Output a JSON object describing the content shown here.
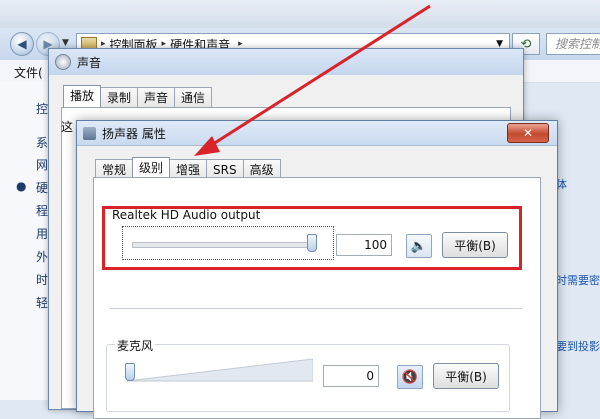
{
  "explorer": {
    "address_crumbs": [
      "控制面板",
      "硬件和声音"
    ],
    "search_placeholder": "搜索控制面",
    "menu": {
      "file": "文件("
    },
    "left_items": [
      "控",
      "系",
      "网",
      "硬",
      "程",
      "用",
      "外",
      "时",
      "轻"
    ],
    "right_fragments": [
      "体",
      "时需要密",
      "要到投影"
    ]
  },
  "sound_dialog": {
    "title": "声音",
    "tabs": [
      "播放",
      "录制",
      "声音",
      "通信"
    ],
    "active_tab": "播放",
    "panel_glyph": "这"
  },
  "speaker_dialog": {
    "title": "扬声器 属性",
    "close_label": "✕",
    "tabs": [
      "常规",
      "级别",
      "增强",
      "SRS",
      "高级"
    ],
    "active_tab": "级别",
    "output": {
      "label": "Realtek HD Audio output",
      "value": "100",
      "level": 1.0,
      "balance_label": "平衡(B)",
      "muted": false
    },
    "microphone": {
      "label": "麦克风",
      "value": "0",
      "level": 0.0,
      "balance_label": "平衡(B)",
      "muted": true
    }
  },
  "colors": {
    "annotation_red": "#d8232a",
    "accent_blue": "#2a5fb0"
  },
  "icons": [
    "back-icon",
    "forward-icon",
    "dropdown-icon",
    "folder-icon",
    "refresh-icon",
    "sound-icon",
    "speaker-icon",
    "speaker-muted-icon",
    "close-icon"
  ]
}
